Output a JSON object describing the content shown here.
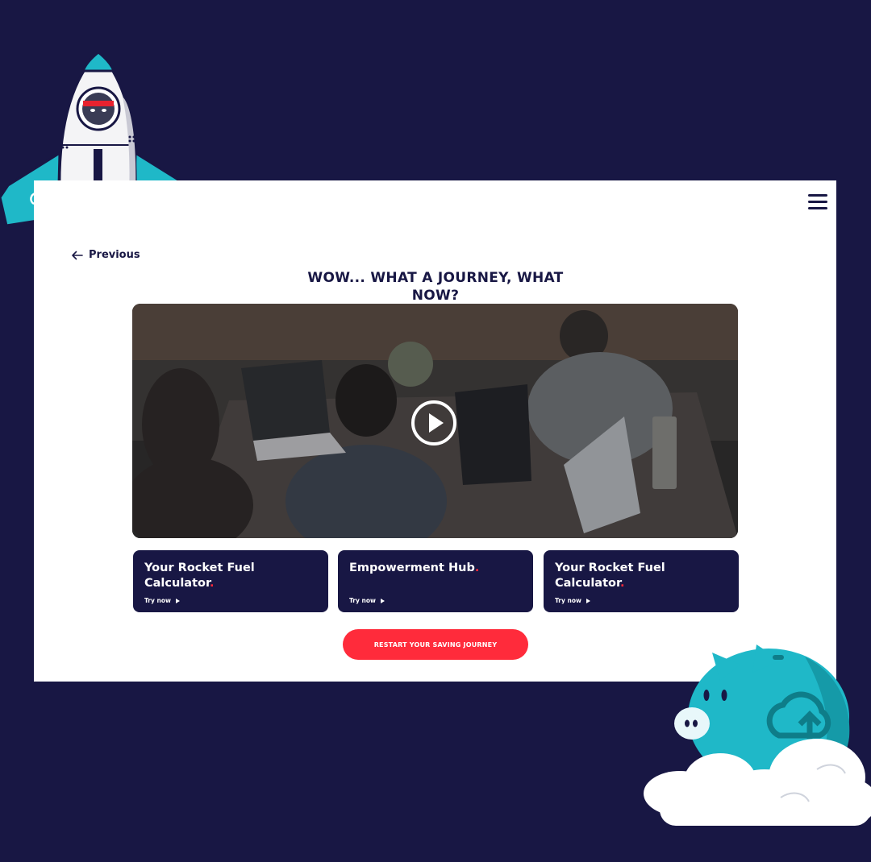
{
  "nav": {
    "previous_label": "Previous"
  },
  "headline": {
    "line1": "WOW... WHAT A JOURNEY, WHAT",
    "line2": "NOW?"
  },
  "tiles": [
    {
      "title": "Your Rocket Fuel Calculator",
      "cta": "Try now"
    },
    {
      "title": "Empowerment Hub",
      "cta": "Try now"
    },
    {
      "title": "Your Rocket Fuel Calculator",
      "cta": "Try now"
    }
  ],
  "restart": {
    "label": "RESTART YOUR SAVING JOURNEY"
  },
  "colors": {
    "navy": "#181744",
    "accent_red": "#ff2b3b",
    "teal": "#1fb8c8",
    "white": "#ffffff"
  },
  "icons": [
    "menu-icon",
    "arrow-left-icon",
    "play-icon",
    "triangle-right-icon",
    "rocket-illustration",
    "piggy-bank-illustration",
    "cloud-upload-icon"
  ]
}
